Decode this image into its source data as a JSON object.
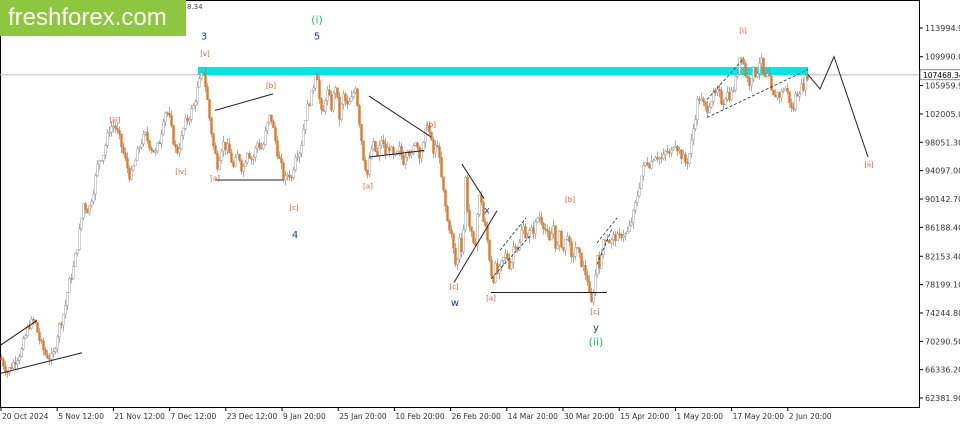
{
  "brand": {
    "logo_text": "freshforex.com",
    "logo_color": "#8dc63f"
  },
  "colors": {
    "bull_body": "#ffffff",
    "bear_body": "#e07a22",
    "wick": "#8a8a8a",
    "resistance_zone": "#00e5e5",
    "current_line": "#bdbdbd",
    "wave_red": "#e0552b",
    "wave_blue": "#1a37c8",
    "wave_green": "#27c25a",
    "axis_text": "#333333",
    "structure_line": "#222222"
  },
  "chart_data": {
    "type": "candlestick",
    "ylim": [
      62381.9,
      113994.9
    ],
    "y_ticks": [
      "113994.90",
      "109990.00",
      "105959.90",
      "102005.00",
      "98051.30",
      "94097.00",
      "90142.70",
      "86188.40",
      "82153.40",
      "78199.10",
      "74244.80",
      "70290.50",
      "66336.20",
      "62381.90"
    ],
    "current_price_label": "107468.34",
    "header_fragment": "8.34",
    "x_ticks": [
      "20 Oct 2024",
      "5 Nov 12:00",
      "21 Nov 12:00",
      "7 Dec 12:00",
      "23 Dec 12:00",
      "9 Jan 20:00",
      "25 Jan 20:00",
      "10 Feb 20:00",
      "26 Feb 20:00",
      "14 Mar 20:00",
      "30 Mar 20:00",
      "15 Apr 20:00",
      "1 May 20:00",
      "17 May 20:00",
      "2 Jun 20:00"
    ],
    "price_path": [
      [
        0,
        68000
      ],
      [
        7,
        66000
      ],
      [
        14,
        67500
      ],
      [
        21,
        69000
      ],
      [
        28,
        72500
      ],
      [
        34,
        73200
      ],
      [
        40,
        70000
      ],
      [
        45,
        68500
      ],
      [
        52,
        67800
      ],
      [
        58,
        72000
      ],
      [
        64,
        74500
      ],
      [
        68,
        78000
      ],
      [
        73,
        80500
      ],
      [
        78,
        84500
      ],
      [
        83,
        89500
      ],
      [
        88,
        88500
      ],
      [
        93,
        91500
      ],
      [
        98,
        95500
      ],
      [
        103,
        96500
      ],
      [
        109,
        100000
      ],
      [
        114,
        100500
      ],
      [
        119,
        98500
      ],
      [
        125,
        95500
      ],
      [
        130,
        93000
      ],
      [
        135,
        95500
      ],
      [
        140,
        98000
      ],
      [
        145,
        99000
      ],
      [
        150,
        97500
      ],
      [
        155,
        96500
      ],
      [
        160,
        98800
      ],
      [
        164,
        102500
      ],
      [
        168,
        102000
      ],
      [
        172,
        99000
      ],
      [
        176,
        96500
      ],
      [
        180,
        98000
      ],
      [
        184,
        100500
      ],
      [
        188,
        101500
      ],
      [
        193,
        103000
      ],
      [
        198,
        106000
      ],
      [
        203,
        108000
      ],
      [
        206,
        105000
      ],
      [
        209,
        101500
      ],
      [
        213,
        97500
      ],
      [
        217,
        95000
      ],
      [
        222,
        98000
      ],
      [
        228,
        97000
      ],
      [
        233,
        94500
      ],
      [
        238,
        96500
      ],
      [
        242,
        94000
      ],
      [
        247,
        97000
      ],
      [
        252,
        95500
      ],
      [
        257,
        98000
      ],
      [
        262,
        97000
      ],
      [
        266,
        100000
      ],
      [
        270,
        102000
      ],
      [
        274,
        99000
      ],
      [
        278,
        96000
      ],
      [
        281,
        94500
      ],
      [
        284,
        92500
      ],
      [
        288,
        94000
      ],
      [
        291,
        93000
      ],
      [
        295,
        96500
      ],
      [
        300,
        97000
      ],
      [
        304,
        101000
      ],
      [
        308,
        103500
      ],
      [
        312,
        105000
      ],
      [
        316,
        109000
      ],
      [
        319,
        104000
      ],
      [
        322,
        101000
      ],
      [
        326,
        105500
      ],
      [
        331,
        103000
      ],
      [
        335,
        106000
      ],
      [
        339,
        101500
      ],
      [
        343,
        104500
      ],
      [
        347,
        103000
      ],
      [
        351,
        104000
      ],
      [
        355,
        106000
      ],
      [
        359,
        101000
      ],
      [
        363,
        96000
      ],
      [
        367,
        93500
      ],
      [
        372,
        98000
      ],
      [
        377,
        96000
      ],
      [
        381,
        98500
      ],
      [
        385,
        96500
      ],
      [
        389,
        97500
      ],
      [
        394,
        95500
      ],
      [
        399,
        97000
      ],
      [
        403,
        95500
      ],
      [
        407,
        97500
      ],
      [
        411,
        96000
      ],
      [
        415,
        98500
      ],
      [
        419,
        96500
      ],
      [
        423,
        97500
      ],
      [
        427,
        101000
      ],
      [
        430,
        98500
      ],
      [
        433,
        96500
      ],
      [
        437,
        98000
      ],
      [
        440,
        94000
      ],
      [
        444,
        90000
      ],
      [
        447,
        87000
      ],
      [
        450,
        86000
      ],
      [
        453,
        83000
      ],
      [
        456,
        80000
      ],
      [
        459,
        85000
      ],
      [
        462,
        82500
      ],
      [
        465,
        93000
      ],
      [
        468,
        87000
      ],
      [
        471,
        85000
      ],
      [
        474,
        82500
      ],
      [
        477,
        88000
      ],
      [
        480,
        91500
      ],
      [
        483,
        87000
      ],
      [
        486,
        85500
      ],
      [
        489,
        82000
      ],
      [
        492,
        78500
      ],
      [
        495,
        80500
      ],
      [
        498,
        79500
      ],
      [
        502,
        81500
      ],
      [
        506,
        82500
      ],
      [
        510,
        80500
      ],
      [
        514,
        84500
      ],
      [
        518,
        83000
      ],
      [
        522,
        86500
      ],
      [
        526,
        85000
      ],
      [
        530,
        85500
      ],
      [
        534,
        86000
      ],
      [
        538,
        88000
      ],
      [
        542,
        87000
      ],
      [
        546,
        85500
      ],
      [
        549,
        84000
      ],
      [
        553,
        86500
      ],
      [
        556,
        82500
      ],
      [
        559,
        85000
      ],
      [
        563,
        83000
      ],
      [
        567,
        85500
      ],
      [
        571,
        81500
      ],
      [
        575,
        83500
      ],
      [
        579,
        82000
      ],
      [
        583,
        80500
      ],
      [
        587,
        79000
      ],
      [
        589,
        76500
      ],
      [
        591,
        75500
      ],
      [
        593,
        77500
      ],
      [
        595,
        79500
      ],
      [
        597,
        82500
      ],
      [
        600,
        80500
      ],
      [
        603,
        84500
      ],
      [
        606,
        85000
      ],
      [
        610,
        84000
      ],
      [
        614,
        85000
      ],
      [
        618,
        84500
      ],
      [
        622,
        85500
      ],
      [
        626,
        85000
      ],
      [
        630,
        86500
      ],
      [
        634,
        88500
      ],
      [
        638,
        91500
      ],
      [
        642,
        94000
      ],
      [
        646,
        95500
      ],
      [
        650,
        95000
      ],
      [
        654,
        96500
      ],
      [
        658,
        96000
      ],
      [
        662,
        95500
      ],
      [
        666,
        97000
      ],
      [
        670,
        96000
      ],
      [
        674,
        98500
      ],
      [
        678,
        97000
      ],
      [
        682,
        96000
      ],
      [
        686,
        95000
      ],
      [
        690,
        97000
      ],
      [
        694,
        101000
      ],
      [
        698,
        104500
      ],
      [
        702,
        103500
      ],
      [
        706,
        102500
      ],
      [
        710,
        104000
      ],
      [
        714,
        104500
      ],
      [
        718,
        105000
      ],
      [
        722,
        103500
      ],
      [
        726,
        105000
      ],
      [
        730,
        104500
      ],
      [
        734,
        106000
      ],
      [
        737,
        108000
      ],
      [
        740,
        111000
      ],
      [
        743,
        109000
      ],
      [
        746,
        107000
      ],
      [
        749,
        106500
      ],
      [
        752,
        108000
      ],
      [
        756,
        107500
      ],
      [
        760,
        110000
      ],
      [
        764,
        106500
      ],
      [
        768,
        107500
      ],
      [
        772,
        104000
      ],
      [
        776,
        105000
      ],
      [
        780,
        104500
      ],
      [
        784,
        106000
      ],
      [
        788,
        104500
      ],
      [
        792,
        102000
      ],
      [
        795,
        104500
      ],
      [
        799,
        105500
      ],
      [
        803,
        106000
      ],
      [
        807,
        107500
      ]
    ],
    "resistance_zone": {
      "x": [
        198,
        808
      ],
      "level": 108000
    },
    "annotations": {
      "wave_red": [
        {
          "text": "[iii]",
          "x": 115,
          "y": 100800
        },
        {
          "text": "[iv]",
          "x": 181,
          "y": 93600
        },
        {
          "text": "[v]",
          "x": 205,
          "y": 110100
        },
        {
          "text": "[a]",
          "x": 215,
          "y": 92700
        },
        {
          "text": "[b]",
          "x": 271,
          "y": 105600
        },
        {
          "text": "[c]",
          "x": 294,
          "y": 88600
        },
        {
          "text": "[a]",
          "x": 368,
          "y": 91600
        },
        {
          "text": "[b]",
          "x": 431,
          "y": 100200
        },
        {
          "text": "[c]",
          "x": 454,
          "y": 77600
        },
        {
          "text": "[a]",
          "x": 491,
          "y": 76000
        },
        {
          "text": "[b]",
          "x": 570,
          "y": 89700
        },
        {
          "text": "[c]",
          "x": 595,
          "y": 74100
        },
        {
          "text": "[i]",
          "x": 743,
          "y": 113300
        },
        {
          "text": "[ii]",
          "x": 869,
          "y": 94600
        }
      ],
      "wave_blue": [
        {
          "text": "3",
          "x": 204,
          "y": 112400
        },
        {
          "text": "5",
          "x": 317,
          "y": 112400
        },
        {
          "text": "4",
          "x": 295,
          "y": 84700
        },
        {
          "text": "x",
          "x": 487,
          "y": 88100
        },
        {
          "text": "w",
          "x": 455,
          "y": 75200
        },
        {
          "text": "y",
          "x": 596,
          "y": 71700
        }
      ],
      "wave_green": [
        {
          "text": "(i)",
          "x": 317,
          "y": 114600
        },
        {
          "text": "(ii)",
          "x": 596,
          "y": 69700
        }
      ]
    },
    "structure_lines": [
      [
        [
          0,
          69700
        ],
        [
          37,
          73200
        ]
      ],
      [
        [
          0,
          65800
        ],
        [
          82,
          68700
        ]
      ],
      [
        [
          215,
          102500
        ],
        [
          273,
          104800
        ]
      ],
      [
        [
          215,
          92800
        ],
        [
          283,
          92800
        ]
      ],
      [
        [
          369,
          104500
        ],
        [
          431,
          98800
        ]
      ],
      [
        [
          369,
          96000
        ],
        [
          424,
          96900
        ]
      ],
      [
        [
          462,
          95000
        ],
        [
          484,
          90200
        ]
      ],
      [
        [
          454,
          78500
        ],
        [
          497,
          88500
        ]
      ],
      [
        [
          491,
          77100
        ],
        [
          607,
          77100
        ]
      ]
    ],
    "dashed_lines": [
      [
        [
          491,
          79000
        ],
        [
          530,
          85000
        ]
      ],
      [
        [
          500,
          83000
        ],
        [
          526,
          87500
        ]
      ],
      [
        [
          597,
          81000
        ],
        [
          612,
          86000
        ]
      ],
      [
        [
          597,
          84000
        ],
        [
          617,
          87500
        ]
      ],
      [
        [
          707,
          104000
        ],
        [
          742,
          109500
        ]
      ],
      [
        [
          707,
          101500
        ],
        [
          808,
          108200
        ]
      ]
    ],
    "projection": [
      [
        808,
        107500
      ],
      [
        820,
        105500
      ],
      [
        834,
        110000
      ],
      [
        868,
        96000
      ]
    ],
    "grid": false,
    "legend": "none"
  }
}
